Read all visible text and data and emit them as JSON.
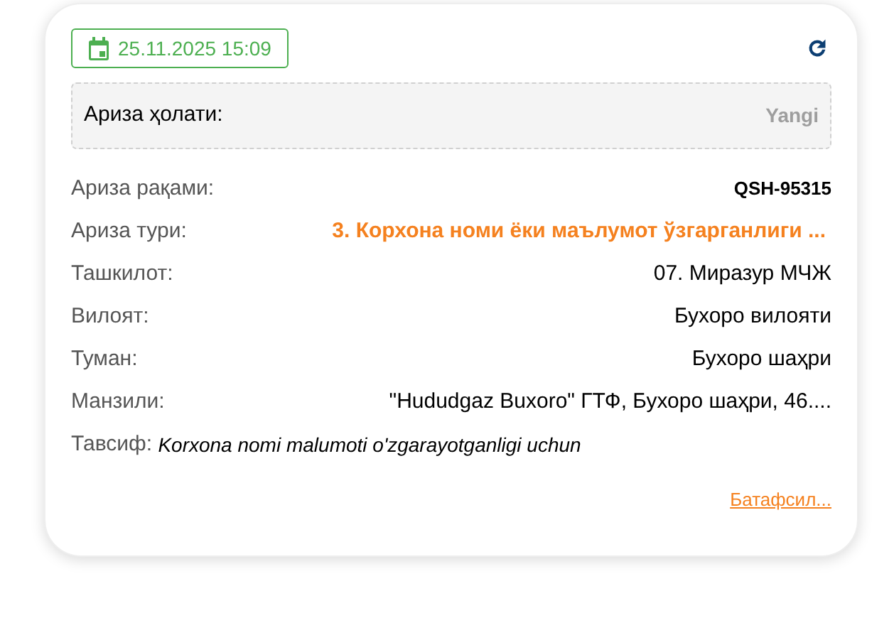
{
  "date": "25.11.2025 15:09",
  "status": {
    "label": "Ариза ҳолати:",
    "value": "Yangi"
  },
  "fields": [
    {
      "label": "Ариза рақами:",
      "value": "QSH-95315",
      "kind": "code"
    },
    {
      "label": "Ариза тури:",
      "value": "3. Корхона номи ёки маълумот ўзгарганлиги ...",
      "kind": "accent"
    },
    {
      "label": "Ташкилот:",
      "value": "07. Миразур МЧЖ",
      "kind": "plain"
    },
    {
      "label": "Вилоят:",
      "value": "Бухоро вилояти",
      "kind": "plain"
    },
    {
      "label": "Туман:",
      "value": "Бухоро шаҳри",
      "kind": "plain"
    },
    {
      "label": "Манзили:",
      "value": "\"Hududgaz Buxoro\" ГТФ, Бухоро шаҳри, 46....",
      "kind": "plain"
    }
  ],
  "description": {
    "label": "Тавсиф:",
    "value": "Korxona nomi malumoti o'zgarayotganligi uchun"
  },
  "more_link": "Батафсил..."
}
